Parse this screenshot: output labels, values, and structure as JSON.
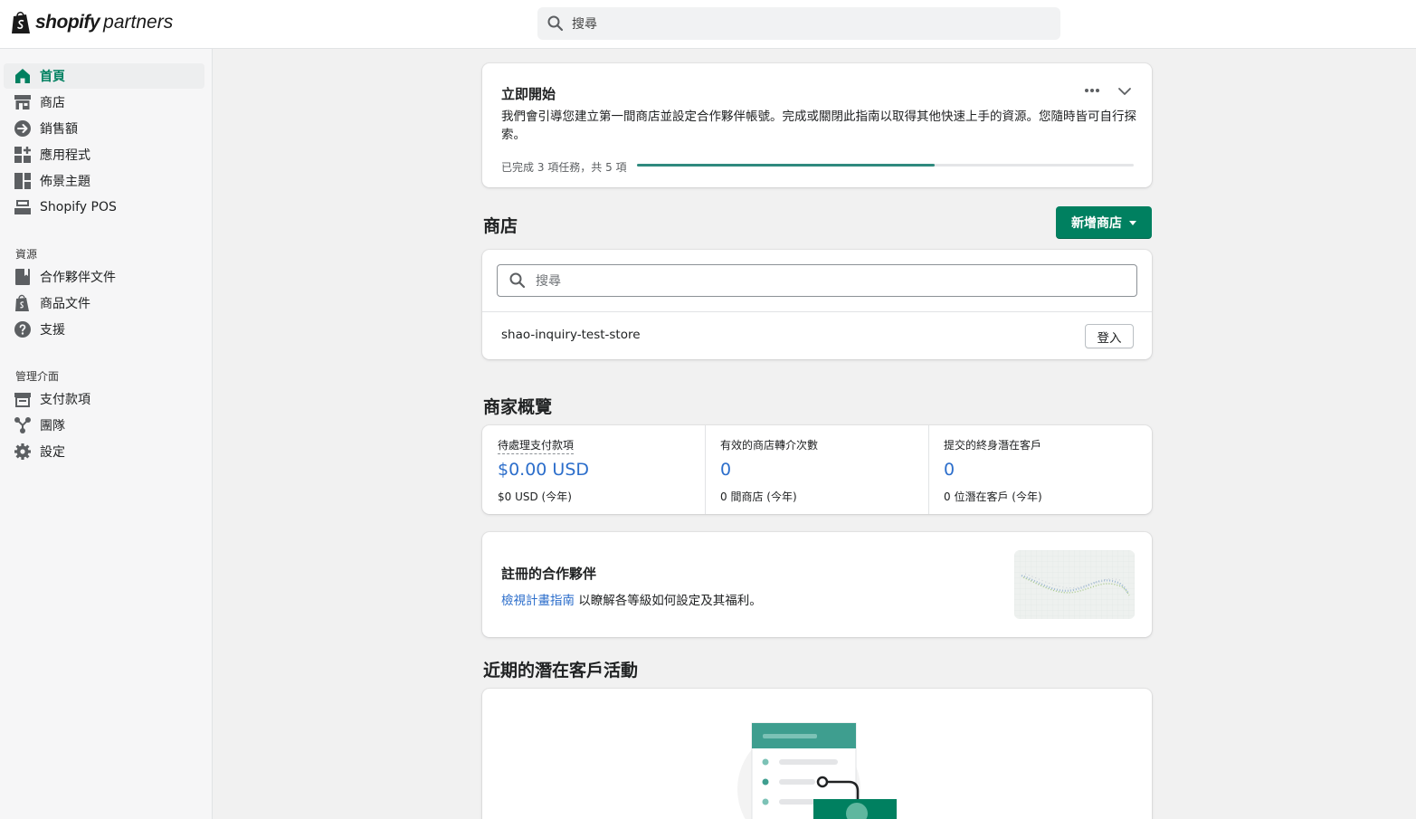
{
  "brand": {
    "word1": "shopify",
    "word2": "partners"
  },
  "top_search": {
    "placeholder": "搜尋"
  },
  "sidebar": {
    "items": [
      {
        "label": "首頁"
      },
      {
        "label": "商店"
      },
      {
        "label": "銷售額"
      },
      {
        "label": "應用程式"
      },
      {
        "label": "佈景主題"
      },
      {
        "label": "Shopify POS"
      }
    ],
    "resources_heading": "資源",
    "resources": [
      {
        "label": "合作夥伴文件"
      },
      {
        "label": "商品文件"
      },
      {
        "label": "支援"
      }
    ],
    "admin_heading": "管理介面",
    "admin": [
      {
        "label": "支付款項"
      },
      {
        "label": "團隊"
      },
      {
        "label": "設定"
      }
    ]
  },
  "getting_started": {
    "title": "立即開始",
    "description": "我們會引導您建立第一間商店並設定合作夥伴帳號。完成或關閉此指南以取得其他快速上手的資源。您隨時皆可自行探索。",
    "progress_text": "已完成 3 項任務，共 5 項",
    "completed": 3,
    "total": 5
  },
  "stores": {
    "title": "商店",
    "add_button": "新增商店",
    "search_placeholder": "搜尋",
    "rows": [
      {
        "name": "shao-inquiry-test-store",
        "action": "登入"
      }
    ]
  },
  "overview": {
    "title": "商家概覽",
    "stats": [
      {
        "label": "待處理支付款項",
        "value": "$0.00 USD",
        "sub": "$0 USD (今年)"
      },
      {
        "label": "有效的商店轉介次數",
        "value": "0",
        "sub": "0 間商店 (今年)"
      },
      {
        "label": "提交的終身潛在客戶",
        "value": "0",
        "sub": "0 位潛在客戶 (今年)"
      }
    ]
  },
  "registered_partner": {
    "title": "註冊的合作夥伴",
    "link_text": "檢視計畫指南",
    "rest_text": " 以瞭解各等級如何設定及其福利。"
  },
  "recent_leads": {
    "title": "近期的潛在客戶活動"
  },
  "colors": {
    "accent": "#008060",
    "link": "#2c6ecb",
    "progress": "#2f8a7e"
  }
}
